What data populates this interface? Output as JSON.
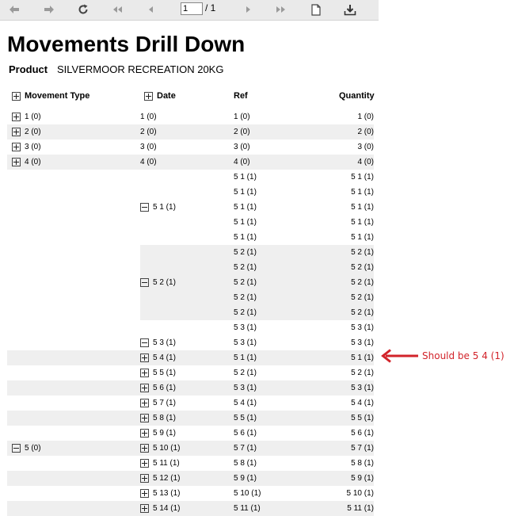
{
  "toolbar": {
    "icons": [
      "back-icon",
      "forward-icon",
      "refresh-icon",
      "first-page-icon",
      "previous-page-icon",
      "next-page-icon",
      "last-page-icon",
      "document-icon",
      "download-icon"
    ],
    "page_value": "1",
    "page_total": "/ 1"
  },
  "report": {
    "title": "Movements Drill Down",
    "product_label": "Product",
    "product_value": "SILVERMOOR RECREATION 20KG"
  },
  "headers": {
    "movement_type": "Movement Type",
    "date": "Date",
    "ref": "Ref",
    "quantity": "Quantity"
  },
  "rows": [
    {
      "mt": "1 (0)",
      "mt_box": "plus",
      "date": "1 (0)",
      "ref": "1 (0)",
      "qty": "1 (0)",
      "shade": false
    },
    {
      "mt": "2 (0)",
      "mt_box": "plus",
      "date": "2 (0)",
      "ref": "2 (0)",
      "qty": "2 (0)",
      "shade": true
    },
    {
      "mt": "3 (0)",
      "mt_box": "plus",
      "date": "3 (0)",
      "ref": "3 (0)",
      "qty": "3 (0)",
      "shade": false
    },
    {
      "mt": "4 (0)",
      "mt_box": "plus",
      "date": "4 (0)",
      "ref": "4 (0)",
      "qty": "4 (0)",
      "shade": true
    },
    {
      "ref": "5 1 (1)",
      "qty": "5 1 (1)"
    },
    {
      "ref": "5 1 (1)",
      "qty": "5 1 (1)"
    },
    {
      "date": "5 1 (1)",
      "date_box": "minus",
      "ref": "5 1 (1)",
      "qty": "5 1 (1)"
    },
    {
      "ref": "5 1 (1)",
      "qty": "5 1 (1)"
    },
    {
      "ref": "5 1 (1)",
      "qty": "5 1 (1)"
    },
    {
      "ref": "5 2 (1)",
      "qty": "5 2 (1)"
    },
    {
      "ref": "5 2 (1)",
      "qty": "5 2 (1)"
    },
    {
      "date": "5 2 (1)",
      "date_box": "minus",
      "ref": "5 2 (1)",
      "qty": "5 2 (1)"
    },
    {
      "ref": "5 2 (1)",
      "qty": "5 2 (1)"
    },
    {
      "ref": "5 2 (1)",
      "qty": "5 2 (1)"
    },
    {
      "ref": "5 3 (1)",
      "qty": "5 3 (1)"
    },
    {
      "date": "5 3 (1)",
      "date_box": "minus",
      "ref": "5 3 (1)",
      "qty": "5 3 (1)"
    },
    {
      "date": "5 4 (1)",
      "date_box": "plus",
      "ref": "5 1 (1)",
      "qty": "5 1 (1)",
      "shade": true
    },
    {
      "date": "5 5 (1)",
      "date_box": "plus",
      "ref": "5 2 (1)",
      "qty": "5 2 (1)"
    },
    {
      "date": "5 6 (1)",
      "date_box": "plus",
      "ref": "5 3 (1)",
      "qty": "5 3 (1)",
      "shade": true
    },
    {
      "date": "5 7 (1)",
      "date_box": "plus",
      "ref": "5 4 (1)",
      "qty": "5 4 (1)"
    },
    {
      "date": "5 8 (1)",
      "date_box": "plus",
      "ref": "5 5 (1)",
      "qty": "5 5 (1)",
      "shade": true
    },
    {
      "date": "5 9 (1)",
      "date_box": "plus",
      "ref": "5 6 (1)",
      "qty": "5 6 (1)"
    },
    {
      "mt": "5 (0)",
      "mt_box": "minus",
      "date": "5 10 (1)",
      "date_box": "plus",
      "ref": "5 7 (1)",
      "qty": "5 7 (1)",
      "shade": true
    },
    {
      "date": "5 11 (1)",
      "date_box": "plus",
      "ref": "5 8 (1)",
      "qty": "5 8 (1)"
    },
    {
      "date": "5 12 (1)",
      "date_box": "plus",
      "ref": "5 9 (1)",
      "qty": "5 9 (1)",
      "shade": true
    },
    {
      "date": "5 13 (1)",
      "date_box": "plus",
      "ref": "5 10 (1)",
      "qty": "5 10 (1)"
    },
    {
      "date": "5 14 (1)",
      "date_box": "plus",
      "ref": "5 11 (1)",
      "qty": "5 11 (1)",
      "shade": true
    }
  ],
  "annotation": {
    "text": "Should be 5 4 (1)",
    "color": "#d2232a"
  }
}
